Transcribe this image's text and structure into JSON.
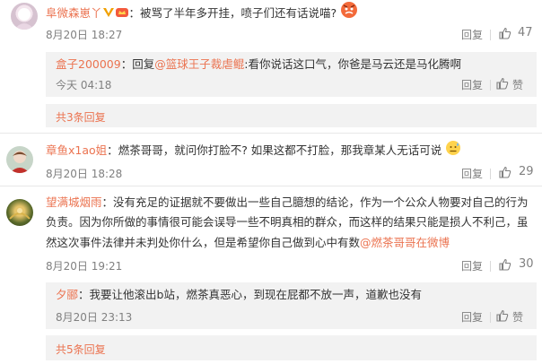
{
  "comments": [
    {
      "user": "阜微森崽丫",
      "text": "被骂了半年多开挂，喷子们还有话说喵?",
      "time": "8月20日 18:27",
      "reply_label": "回复",
      "likes": "47",
      "subreplies": [
        {
          "user": "盒子200009",
          "prefix": "回复",
          "at": "@篮球王子裁虐鲲",
          "text": ":看你说话这口气，你爸是马云还是马化腾啊",
          "time": "今天 04:18",
          "reply_label": "回复",
          "like_label": "赞"
        }
      ],
      "more": "共3条回复"
    },
    {
      "user": "章鱼x1ao姐",
      "text": "燃茶哥哥，就问你打脸不? 如果这都不打脸，那我章某人无话可说",
      "time": "8月20日 18:28",
      "reply_label": "回复",
      "likes": "29"
    },
    {
      "user": "望满城烟雨",
      "text_line1": "没有充足的证据就不要做出一些自己臆想的结论，作为一个公众人物要对自己的行为",
      "text_line2": "负责。因为你所做的事情很可能会误导一些不明真相的群众，而这样的结果只能是损人不利己，虽",
      "text_line3": "然这次事件法律并未判处你什么，但是希望你自己做到心中有数",
      "at": "@燃茶哥哥在微博",
      "time": "8月20日 19:21",
      "reply_label": "回复",
      "likes": "30",
      "subreplies": [
        {
          "user": "夕郦",
          "text": "我要让他滚出b站，燃茶真恶心，到现在屁都不放一声，道歉也没有",
          "time": "8月20日 23:13",
          "reply_label": "回复",
          "like_label": "赞"
        }
      ],
      "more": "共5条回复"
    }
  ],
  "colors": {
    "accent": "#eb7350",
    "muted": "#808080",
    "subbg": "#f2f2f2"
  },
  "icons": [
    "avatar",
    "vip-badge",
    "crown-badge",
    "angry-emoji",
    "sweat-emoji",
    "thumbs-up-icon"
  ]
}
